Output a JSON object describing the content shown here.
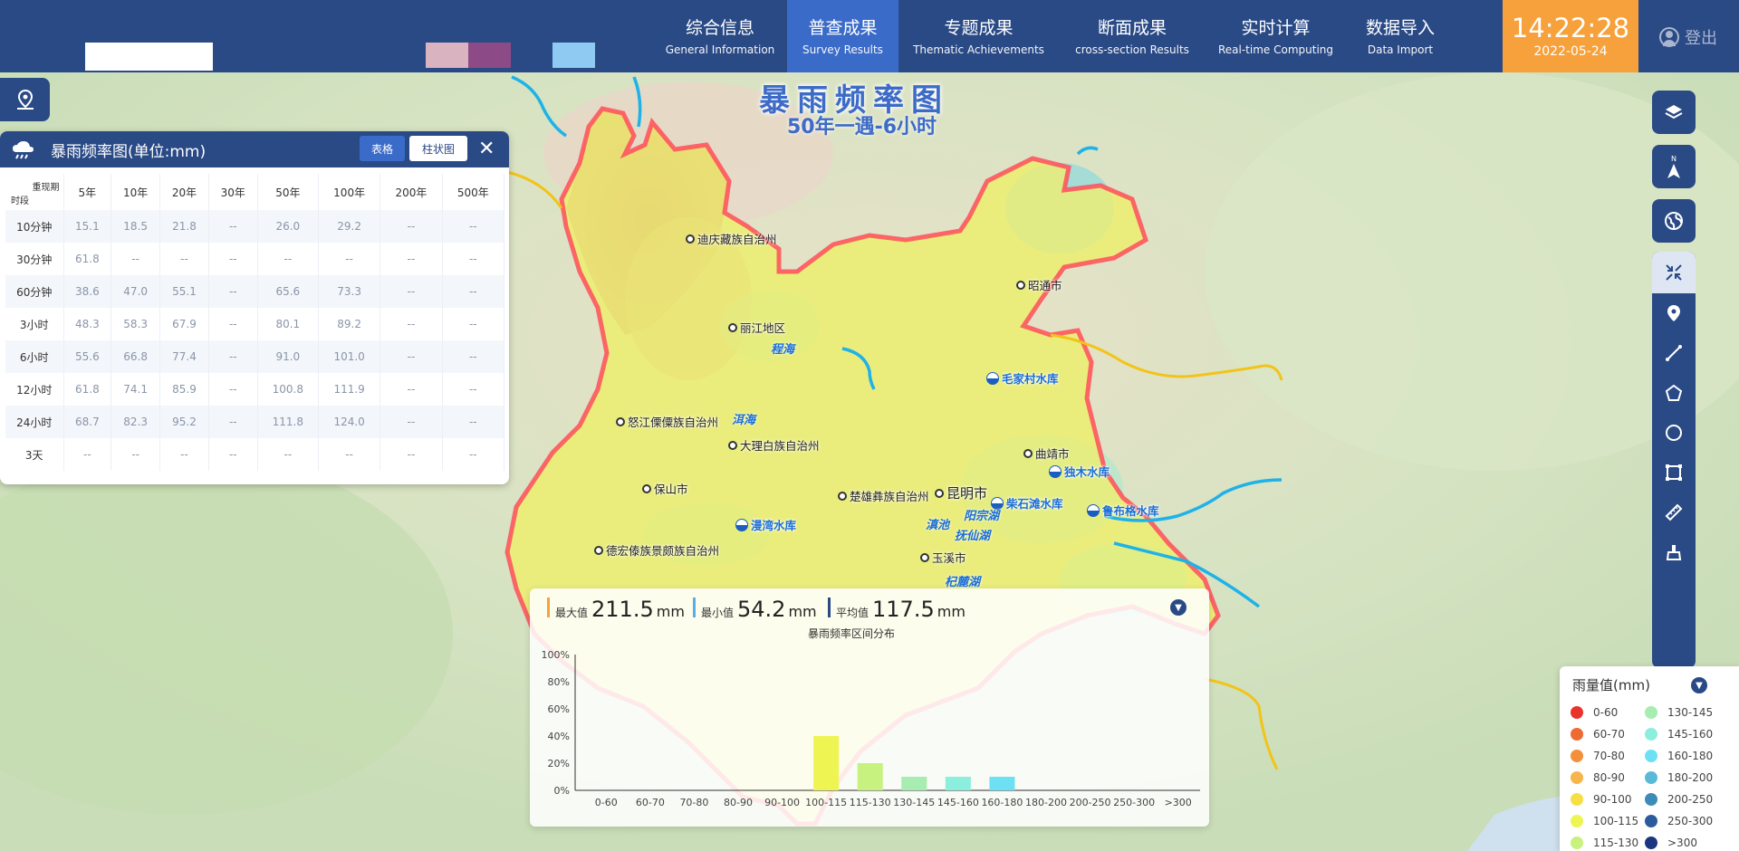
{
  "header": {
    "nav": [
      {
        "cn": "综合信息",
        "en": "General Information"
      },
      {
        "cn": "普查成果",
        "en": "Survey Results",
        "active": true
      },
      {
        "cn": "专题成果",
        "en": "Thematic Achievements"
      },
      {
        "cn": "断面成果",
        "en": "cross-section Results"
      },
      {
        "cn": "实时计算",
        "en": "Real-time Computing"
      },
      {
        "cn": "数据导入",
        "en": "Data Import"
      }
    ],
    "clock": {
      "time": "14:22:28",
      "date": "2022-05-24"
    },
    "logout": "登出",
    "swatch_colors": [
      "#d9b4c0",
      "#8c4a86",
      "#8fcaf2"
    ]
  },
  "map": {
    "title": "暴雨频率图",
    "subtitle": "50年一遇-6小时",
    "cities": [
      "迪庆藏族自治州",
      "昭通市",
      "丽江地区",
      "怒江傈僳族自治州",
      "大理白族自治州",
      "曲靖市",
      "保山市",
      "楚雄彝族自治州",
      "昆明市",
      "德宏傣族景颇族自治州",
      "玉溪市"
    ],
    "reservoirs": [
      "毛家村水库",
      "独木水库",
      "柴石滩水库",
      "鲁布格水库",
      "漫湾水库"
    ],
    "lakes": [
      "程海",
      "洱海",
      "滇池",
      "阳宗湖",
      "抚仙湖",
      "杞麓湖"
    ]
  },
  "table_panel": {
    "title": "暴雨频率图(单位:mm)",
    "tab_table": "表格",
    "tab_bar": "柱状图",
    "corner_top": "重现期",
    "corner_bottom": "时段",
    "columns": [
      "5年",
      "10年",
      "20年",
      "30年",
      "50年",
      "100年",
      "200年",
      "500年"
    ],
    "rows": [
      {
        "label": "10分钟",
        "values": [
          "15.1",
          "18.5",
          "21.8",
          "--",
          "26.0",
          "29.2",
          "--",
          "--"
        ]
      },
      {
        "label": "30分钟",
        "values": [
          "61.8",
          "--",
          "--",
          "--",
          "--",
          "--",
          "--",
          "--"
        ]
      },
      {
        "label": "60分钟",
        "values": [
          "38.6",
          "47.0",
          "55.1",
          "--",
          "65.6",
          "73.3",
          "--",
          "--"
        ]
      },
      {
        "label": "3小时",
        "values": [
          "48.3",
          "58.3",
          "67.9",
          "--",
          "80.1",
          "89.2",
          "--",
          "--"
        ]
      },
      {
        "label": "6小时",
        "values": [
          "55.6",
          "66.8",
          "77.4",
          "--",
          "91.0",
          "101.0",
          "--",
          "--"
        ]
      },
      {
        "label": "12小时",
        "values": [
          "61.8",
          "74.1",
          "85.9",
          "--",
          "100.8",
          "111.9",
          "--",
          "--"
        ]
      },
      {
        "label": "24小时",
        "values": [
          "68.7",
          "82.3",
          "95.2",
          "--",
          "111.8",
          "124.0",
          "--",
          "--"
        ]
      },
      {
        "label": "3天",
        "values": [
          "--",
          "--",
          "--",
          "--",
          "--",
          "--",
          "--",
          "--"
        ]
      }
    ]
  },
  "stats": {
    "max_label": "最大值",
    "max_value": "211.5",
    "max_unit": "mm",
    "max_color": "#f6a13b",
    "min_label": "最小值",
    "min_value": "54.2",
    "min_unit": "mm",
    "min_color": "#5aaee8",
    "avg_label": "平均值",
    "avg_value": "117.5",
    "avg_unit": "mm",
    "avg_color": "#2a4a86"
  },
  "chart_data": {
    "type": "bar",
    "title": "暴雨频率区间分布",
    "categories": [
      "0-60",
      "60-70",
      "70-80",
      "80-90",
      "90-100",
      "100-115",
      "115-130",
      "130-145",
      "145-160",
      "160-180",
      "180-200",
      "200-250",
      "250-300",
      ">300"
    ],
    "values": [
      0,
      0,
      0,
      0,
      0,
      40,
      20,
      10,
      10,
      10,
      0,
      0,
      0,
      0
    ],
    "colors": [
      "#e8342a",
      "#ef6a33",
      "#f5903a",
      "#f8b54a",
      "#f6df45",
      "#eef553",
      "#c8f27f",
      "#a7ecb0",
      "#8ceedd",
      "#6ee0f4",
      "#5bb9d8",
      "#3e8bb8",
      "#2b5b9c",
      "#1b3680"
    ],
    "yticks": [
      "0%",
      "20%",
      "40%",
      "60%",
      "80%",
      "100%"
    ],
    "ylim": [
      0,
      100
    ],
    "grid": false
  },
  "legend": {
    "title": "雨量值(mm)",
    "items": [
      {
        "label": "0-60",
        "color": "#e8342a"
      },
      {
        "label": "60-70",
        "color": "#ef6a33"
      },
      {
        "label": "70-80",
        "color": "#f5903a"
      },
      {
        "label": "80-90",
        "color": "#f8b54a"
      },
      {
        "label": "90-100",
        "color": "#f6df45"
      },
      {
        "label": "100-115",
        "color": "#eef553"
      },
      {
        "label": "115-130",
        "color": "#c8f27f"
      },
      {
        "label": "130-145",
        "color": "#a7ecb0"
      },
      {
        "label": "145-160",
        "color": "#8ceedd"
      },
      {
        "label": "160-180",
        "color": "#6ee0f4"
      },
      {
        "label": "180-200",
        "color": "#5bb9d8"
      },
      {
        "label": "200-250",
        "color": "#3e8bb8"
      },
      {
        "label": "250-300",
        "color": "#2b5b9c"
      },
      {
        "label": ">300",
        "color": "#1b3680"
      }
    ]
  },
  "toolbar": [
    "layers-icon",
    "compass-icon",
    "globe-icon",
    "fullscreen-exit-icon",
    "map-pin-icon",
    "line-icon",
    "polygon-icon",
    "circle-icon",
    "rectangle-icon",
    "ruler-icon",
    "clear-icon"
  ]
}
